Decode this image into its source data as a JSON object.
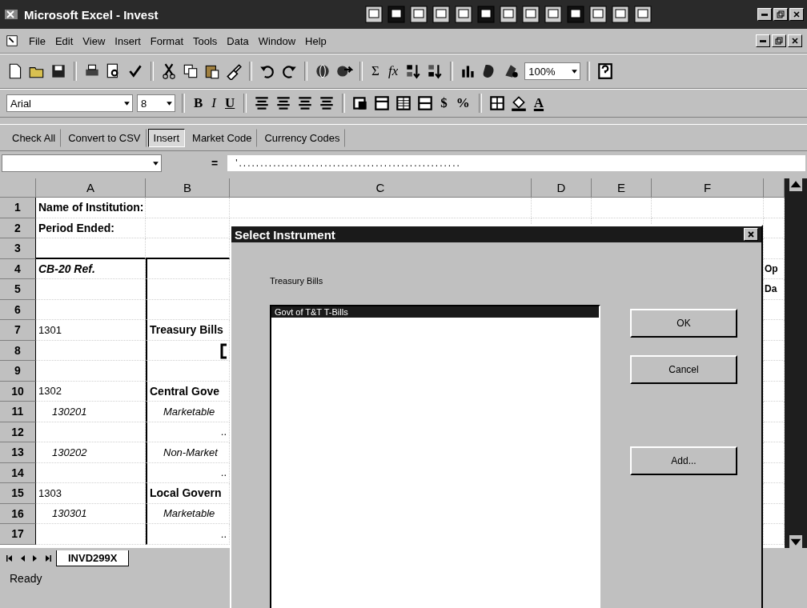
{
  "window": {
    "title": "Microsoft Excel - Invest"
  },
  "menu": [
    "File",
    "Edit",
    "View",
    "Insert",
    "Format",
    "Tools",
    "Data",
    "Window",
    "Help"
  ],
  "standard_toolbar": {
    "sum_symbol": "Σ",
    "function_symbol": "fx",
    "zoom": "100%"
  },
  "formatting_toolbar": {
    "font": "Arial",
    "size": "8",
    "style_buttons": [
      "B",
      "I",
      "U"
    ],
    "number_buttons": [
      "$",
      "%"
    ],
    "font_color_letter": "A"
  },
  "custom_toolbar": [
    {
      "label": "Check All",
      "selected": false
    },
    {
      "label": "Convert to CSV",
      "selected": false
    },
    {
      "label": "Insert",
      "selected": true
    },
    {
      "label": "Market Code",
      "selected": false
    },
    {
      "label": "Currency Codes",
      "selected": false
    }
  ],
  "formula_bar": {
    "equals_sign": "=",
    "content": "'...................................................."
  },
  "sheet": {
    "columns": [
      "A",
      "B",
      "C",
      "D",
      "E",
      "F"
    ],
    "rows": [
      {
        "number": "1",
        "a": {
          "text": "Name of Institution:",
          "kind": "bold"
        }
      },
      {
        "number": "2",
        "a": {
          "text": "Period Ended:",
          "kind": "bold"
        }
      },
      {
        "number": "3"
      },
      {
        "number": "4",
        "a": {
          "text": "CB-20 Ref.",
          "kind": "bolditalic"
        },
        "column_g": {
          "text": "Op",
          "kind": "bold"
        }
      },
      {
        "number": "5",
        "column_g": {
          "text": "Da",
          "kind": "bold"
        }
      },
      {
        "number": "6"
      },
      {
        "number": "7",
        "a": {
          "text": "1301",
          "kind": "plain"
        },
        "b": {
          "text": "Treasury Bills",
          "kind": "bold"
        }
      },
      {
        "number": "8"
      },
      {
        "number": "9"
      },
      {
        "number": "10",
        "a": {
          "text": "1302",
          "kind": "plain"
        },
        "b": {
          "text": "Central Gove",
          "kind": "bold"
        }
      },
      {
        "number": "11",
        "a": {
          "text": "130201",
          "kind": "italic"
        },
        "b": {
          "text": "Marketable",
          "kind": "italic"
        }
      },
      {
        "number": "12",
        "b": {
          "text": "..",
          "kind": "dots"
        }
      },
      {
        "number": "13",
        "a": {
          "text": "130202",
          "kind": "italic"
        },
        "b": {
          "text": "Non-Market",
          "kind": "italic"
        }
      },
      {
        "number": "14",
        "b": {
          "text": "..",
          "kind": "dots"
        }
      },
      {
        "number": "15",
        "a": {
          "text": "1303",
          "kind": "plain"
        },
        "b": {
          "text": "Local Govern",
          "kind": "bold"
        }
      },
      {
        "number": "16",
        "a": {
          "text": "130301",
          "kind": "italic"
        },
        "b": {
          "text": "Marketable",
          "kind": "italic"
        }
      },
      {
        "number": "17",
        "b": {
          "text": "..",
          "kind": "dots"
        }
      }
    ]
  },
  "sheet_tabs": [
    {
      "label": "INVD299X",
      "selected": true
    }
  ],
  "status_bar": {
    "text": "Ready"
  },
  "dialog": {
    "title": "Select Instrument",
    "label": "Treasury Bills",
    "items": [
      {
        "label": "Govt of T&T T-Bills",
        "selected": true
      }
    ],
    "buttons": [
      "OK",
      "Cancel",
      "Add..."
    ]
  }
}
